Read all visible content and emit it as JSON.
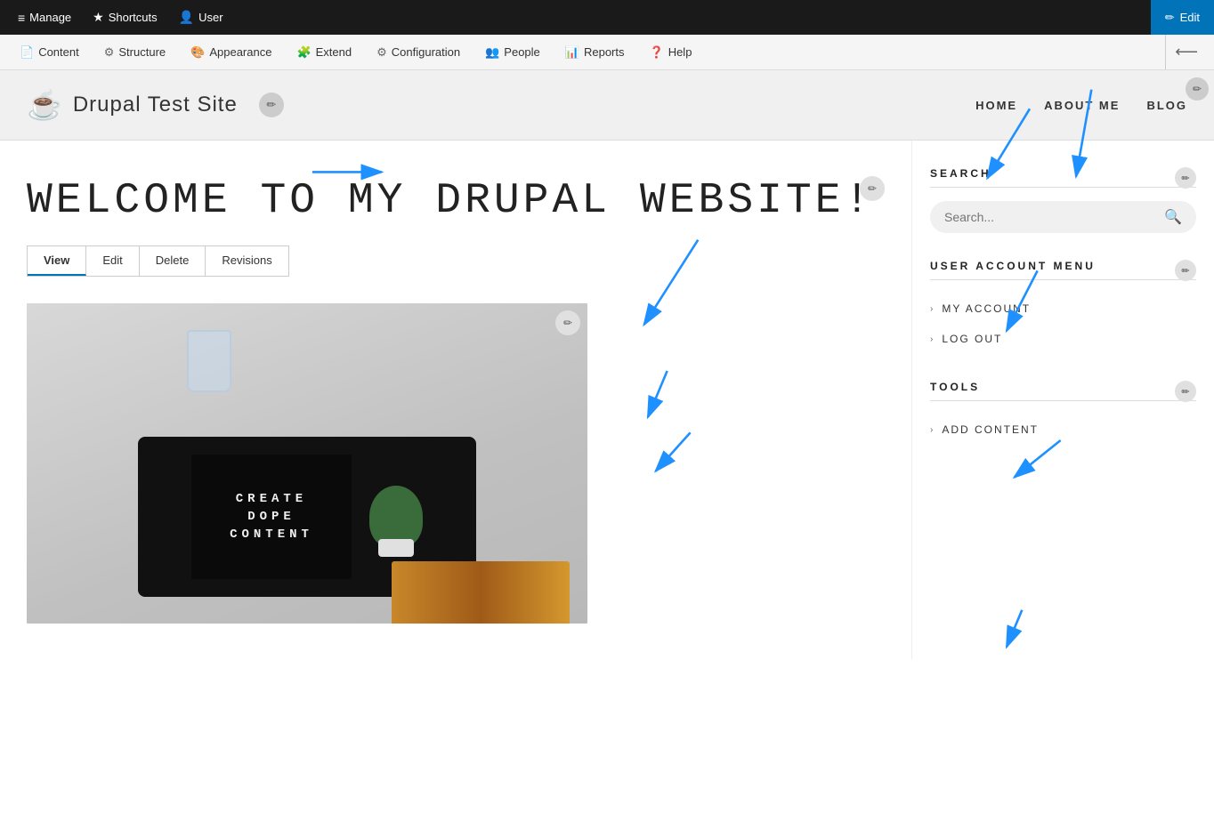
{
  "admin_toolbar": {
    "items": [
      {
        "label": "Manage",
        "icon": "≡",
        "id": "manage"
      },
      {
        "label": "Shortcuts",
        "icon": "★",
        "id": "shortcuts"
      },
      {
        "label": "User",
        "icon": "👤",
        "id": "user"
      }
    ],
    "edit_label": "Edit",
    "edit_icon": "✏"
  },
  "secondary_nav": {
    "items": [
      {
        "label": "Content",
        "icon": "📄",
        "id": "content"
      },
      {
        "label": "Structure",
        "icon": "⚙",
        "id": "structure"
      },
      {
        "label": "Appearance",
        "icon": "🎨",
        "id": "appearance"
      },
      {
        "label": "Extend",
        "icon": "🧩",
        "id": "extend"
      },
      {
        "label": "Configuration",
        "icon": "⚙",
        "id": "configuration"
      },
      {
        "label": "People",
        "icon": "👥",
        "id": "people"
      },
      {
        "label": "Reports",
        "icon": "📊",
        "id": "reports"
      },
      {
        "label": "Help",
        "icon": "❓",
        "id": "help"
      }
    ],
    "right_icon": "⟵"
  },
  "site_header": {
    "logo_icon": "☕",
    "title": "Drupal Test Site",
    "nav_items": [
      {
        "label": "HOME",
        "id": "home"
      },
      {
        "label": "ABOUT ME",
        "id": "about"
      },
      {
        "label": "BLOG",
        "id": "blog"
      }
    ]
  },
  "main_content": {
    "page_title": "WELCOME TO MY DRUPAL WEBSITE!",
    "tabs": [
      {
        "label": "View",
        "id": "view",
        "active": true
      },
      {
        "label": "Edit",
        "id": "edit",
        "active": false
      },
      {
        "label": "Delete",
        "id": "delete",
        "active": false
      },
      {
        "label": "Revisions",
        "id": "revisions",
        "active": false
      }
    ],
    "letter_board_lines": [
      "CREATE",
      "DOPE",
      "CONTENT"
    ]
  },
  "sidebar": {
    "search_block": {
      "title": "SEARCH",
      "placeholder": "Search..."
    },
    "user_account_menu": {
      "title": "USER ACCOUNT MENU",
      "items": [
        {
          "label": "MY ACCOUNT",
          "id": "my-account"
        },
        {
          "label": "LOG OUT",
          "id": "log-out"
        }
      ]
    },
    "tools_block": {
      "title": "TOOLS",
      "items": [
        {
          "label": "ADD CONTENT",
          "id": "add-content"
        }
      ]
    }
  },
  "pencil_icon": "✏",
  "search_icon": "🔍"
}
